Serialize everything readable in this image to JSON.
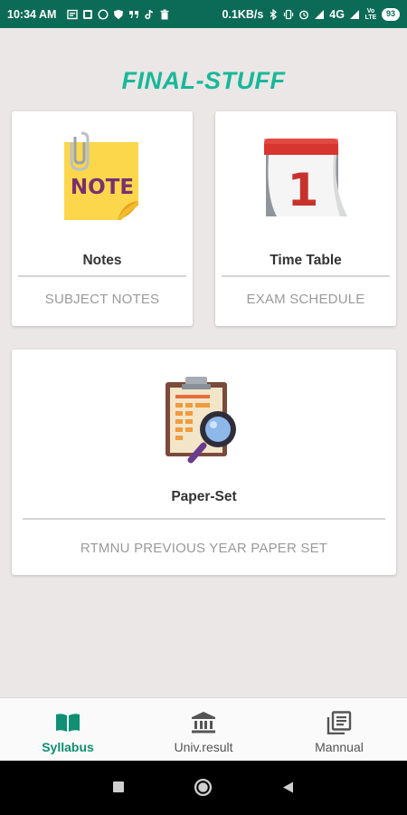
{
  "status_bar": {
    "time": "10:34 AM",
    "speed": "0.1KB/s",
    "network": "4G",
    "volte": "Vo LTE",
    "battery": "93"
  },
  "app": {
    "title": "FINAL-STUFF"
  },
  "cards": {
    "notes": {
      "title": "Notes",
      "subtitle": "SUBJECT NOTES",
      "icon_text": "NOTE"
    },
    "timetable": {
      "title": "Time Table",
      "subtitle": "EXAM SCHEDULE",
      "icon_text": "1"
    },
    "paperset": {
      "title": "Paper-Set",
      "subtitle": "RTMNU PREVIOUS YEAR PAPER SET"
    }
  },
  "bottom_nav": {
    "items": [
      {
        "label": "Syllabus",
        "icon": "book-open-icon",
        "active": true
      },
      {
        "label": "Univ.result",
        "icon": "bank-icon",
        "active": false
      },
      {
        "label": "Mannual",
        "icon": "library-books-icon",
        "active": false
      }
    ]
  },
  "colors": {
    "status_bar": "#0c6b56",
    "accent": "#18b89a",
    "active_nav": "#0f8f74",
    "background": "#ebe7e6"
  }
}
